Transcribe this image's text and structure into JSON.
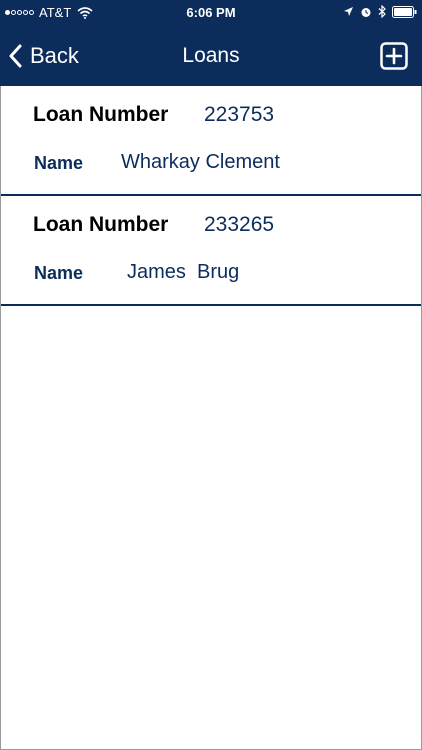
{
  "status_bar": {
    "carrier": "AT&T",
    "time": "6:06 PM",
    "signal_icon": "signal-dots-icon",
    "wifi_icon": "wifi-icon",
    "location_icon": "location-arrow-icon",
    "alarm_icon": "alarm-icon",
    "bluetooth_icon": "bluetooth-icon",
    "battery_icon": "battery-icon"
  },
  "nav": {
    "back_label": "Back",
    "back_icon": "chevron-left-icon",
    "title": "Loans",
    "add_icon": "plus-square-icon"
  },
  "loans": [
    {
      "number_label": "Loan Number",
      "number": "223753",
      "name_label": "Name",
      "name": "Wharkay Clement"
    },
    {
      "number_label": "Loan Number",
      "number": "233265",
      "name_label": "Name",
      "name": "James  Brug"
    }
  ],
  "colors": {
    "header_bg": "#0c2d5c",
    "header_text": "#ffffff",
    "accent_text": "#0c2d5c",
    "divider": "#0c2d5c"
  }
}
